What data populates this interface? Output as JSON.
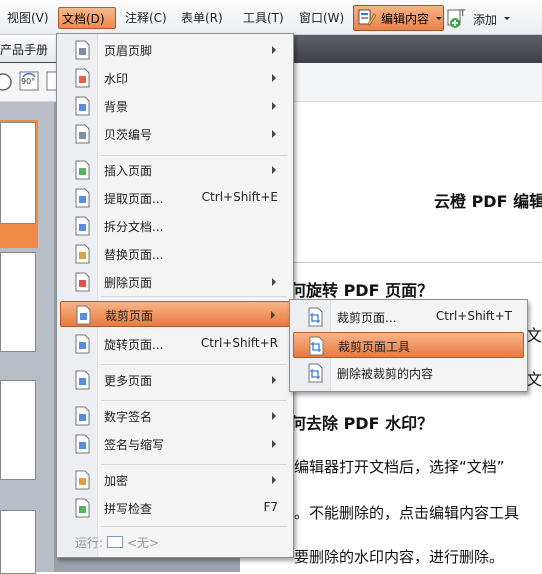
{
  "menubar": {
    "items": [
      "视图(V)",
      "文档(D)",
      "注释(C)",
      "表单(R)",
      "工具(T)",
      "窗口(W)"
    ],
    "edit_content": "编辑内容",
    "add": "添加"
  },
  "tab": {
    "title": "产品手册"
  },
  "toolbar": {
    "rotate": "90°"
  },
  "menu": {
    "items": [
      {
        "label": "页眉页脚",
        "shortcut": "",
        "submenu": true,
        "icon": "header-footer-icon"
      },
      {
        "label": "水印",
        "shortcut": "",
        "submenu": true,
        "icon": "watermark-icon"
      },
      {
        "label": "背景",
        "shortcut": "",
        "submenu": true,
        "icon": "background-icon"
      },
      {
        "label": "贝茨编号",
        "shortcut": "",
        "submenu": true,
        "icon": "bates-number-icon"
      },
      {
        "label": "插入页面",
        "shortcut": "",
        "submenu": true,
        "icon": "insert-page-icon"
      },
      {
        "label": "提取页面...",
        "shortcut": "Ctrl+Shift+E",
        "submenu": false,
        "icon": "extract-page-icon"
      },
      {
        "label": "拆分文档...",
        "shortcut": "",
        "submenu": false,
        "icon": "split-document-icon"
      },
      {
        "label": "替换页面...",
        "shortcut": "",
        "submenu": false,
        "icon": "replace-page-icon"
      },
      {
        "label": "删除页面",
        "shortcut": "",
        "submenu": true,
        "icon": "delete-page-icon"
      },
      {
        "label": "裁剪页面",
        "shortcut": "",
        "submenu": true,
        "icon": "crop-page-icon"
      },
      {
        "label": "旋转页面...",
        "shortcut": "Ctrl+Shift+R",
        "submenu": false,
        "icon": "rotate-page-icon"
      },
      {
        "label": "更多页面",
        "shortcut": "",
        "submenu": true,
        "icon": "more-pages-icon"
      },
      {
        "label": "数字签名",
        "shortcut": "",
        "submenu": true,
        "icon": "digital-signature-icon"
      },
      {
        "label": "签名与缩写",
        "shortcut": "",
        "submenu": true,
        "icon": "sign-initials-icon"
      },
      {
        "label": "加密",
        "shortcut": "",
        "submenu": true,
        "icon": "encrypt-icon"
      },
      {
        "label": "拼写检查",
        "shortcut": "F7",
        "submenu": false,
        "icon": "spell-check-icon"
      }
    ],
    "run_label": "运行:",
    "run_value": "<无>"
  },
  "submenu": {
    "items": [
      {
        "label": "裁剪页面...",
        "shortcut": "Ctrl+Shift+T"
      },
      {
        "label": "裁剪页面工具",
        "shortcut": ""
      },
      {
        "label": "删除被裁剪的内容",
        "shortcut": ""
      }
    ]
  },
  "document": {
    "heading": "云橙 PDF 编辑",
    "q1": "何旋转  PDF  页面？",
    "frag1": "文档",
    "frag2": "文档",
    "q2": "何去除  PDF  水印？",
    "line1": "编辑器打开文档后，选择“文档”",
    "line2": "。不能删除的，点击编辑内容工具",
    "line3": "要删除的水印内容，进行删除。"
  },
  "colors": {
    "accent": "#ee8a4d",
    "tabstrip": "#4a4d53"
  }
}
